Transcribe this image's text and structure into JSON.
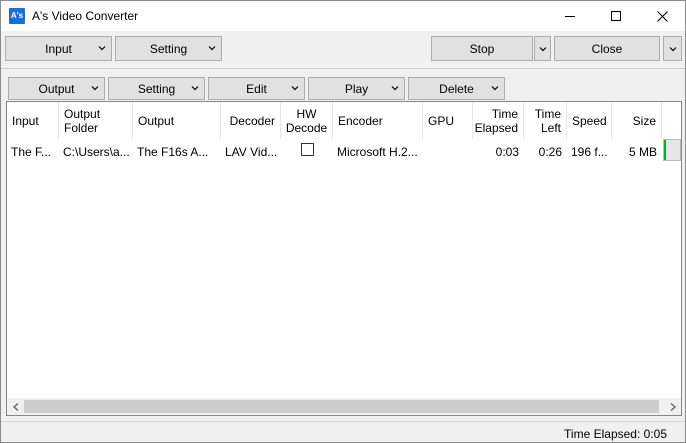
{
  "window": {
    "title": "A's Video Converter",
    "icon_text": "A's"
  },
  "toolbar_top": {
    "input": "Input",
    "setting": "Setting",
    "stop": "Stop",
    "close": "Close"
  },
  "toolbar_list": {
    "output": "Output",
    "setting": "Setting",
    "edit": "Edit",
    "play": "Play",
    "delete": "Delete"
  },
  "columns": {
    "input": "Input",
    "output_folder": "Output Folder",
    "output": "Output",
    "decoder": "Decoder",
    "hw_decode": "HW Decode",
    "encoder": "Encoder",
    "gpu": "GPU",
    "time_elapsed": "Time Elapsed",
    "time_left": "Time Left",
    "speed": "Speed",
    "size": "Size"
  },
  "rows": [
    {
      "input": "The F...",
      "output_folder": "C:\\Users\\a...",
      "output": "The F16s  A...",
      "decoder": "LAV Vid...",
      "hw_decode": false,
      "encoder": "Microsoft H.2...",
      "gpu": "",
      "time_elapsed": "0:03",
      "time_left": "0:26",
      "speed": "196 f...",
      "size": "5 MB",
      "progress_fraction": 0.1
    }
  ],
  "status": {
    "time_elapsed": "Time Elapsed: 0:05"
  },
  "colors": {
    "progress": "#06b025",
    "icon_bg": "#1a6fd6"
  }
}
